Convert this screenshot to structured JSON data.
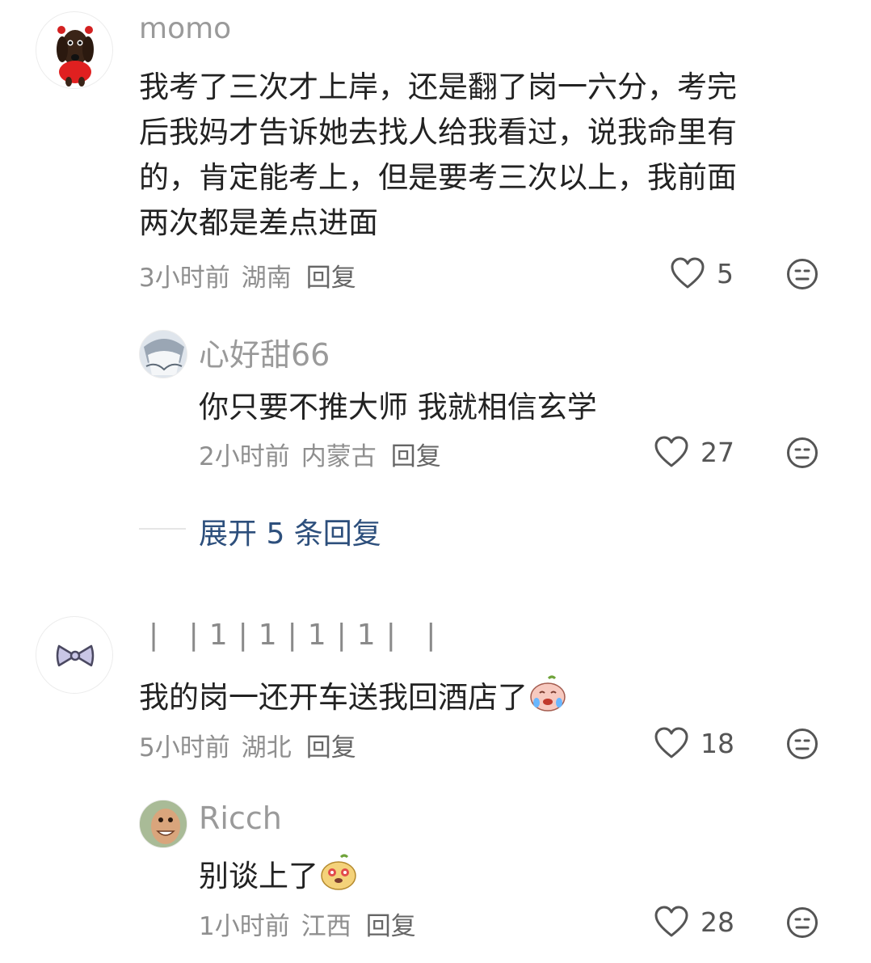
{
  "comments": [
    {
      "user": "momo",
      "text_lines": [
        "我考了三次才上岸，还是翻了岗一六分，考完",
        "后我妈才告诉她去找人给我看过，说我命里有",
        "的，肯定能考上，但是要考三次以上，我前面",
        "两次都是差点进面"
      ],
      "time": "3小时前",
      "location": "湖南",
      "reply": "回复",
      "likes": "5",
      "replies": [
        {
          "user": "心好甜66",
          "text": "你只要不推大师 我就相信玄学",
          "time": "2小时前",
          "location": "内蒙古",
          "reply": "回复",
          "likes": "27"
        }
      ],
      "expand": "展开 5 条回复"
    },
    {
      "user": "| |1|1|1|1| |",
      "text": "我的岗一还开车送我回酒店了",
      "emoji": "crying-face-sticker",
      "time": "5小时前",
      "location": "湖北",
      "reply": "回复",
      "likes": "18",
      "replies": [
        {
          "user": "Ricch",
          "text": "别谈上了",
          "emoji": "heart-eyes-sticker",
          "time": "1小时前",
          "location": "江西",
          "reply": "回复",
          "likes": "28"
        }
      ]
    }
  ]
}
